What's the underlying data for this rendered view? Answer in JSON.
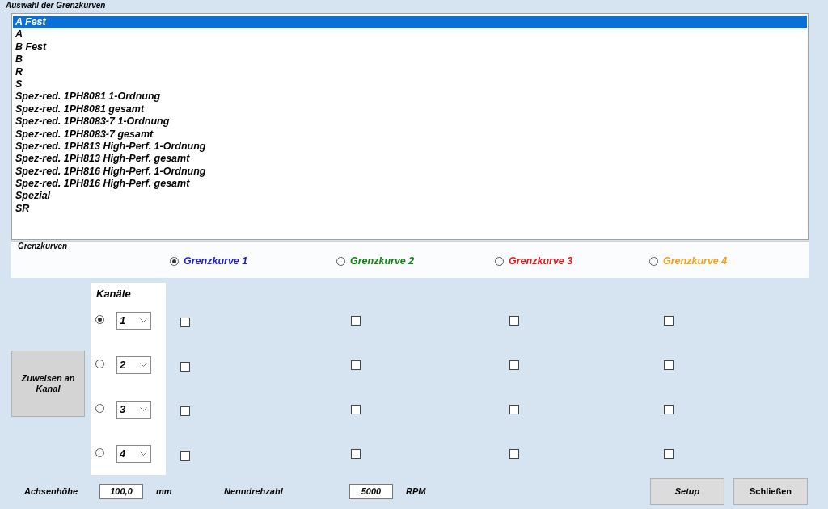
{
  "title": "Auswahl der Grenzkurven",
  "curve_list": {
    "items": [
      {
        "label": "A Fest",
        "selected": true
      },
      {
        "label": "A",
        "selected": false
      },
      {
        "label": "B Fest",
        "selected": false
      },
      {
        "label": "B",
        "selected": false
      },
      {
        "label": "R",
        "selected": false
      },
      {
        "label": "S",
        "selected": false
      },
      {
        "label": "Spez-red. 1PH8081 1-Ordnung",
        "selected": false
      },
      {
        "label": "Spez-red. 1PH8081 gesamt",
        "selected": false
      },
      {
        "label": "Spez-red. 1PH8083-7 1-Ordnung",
        "selected": false
      },
      {
        "label": "Spez-red. 1PH8083-7 gesamt",
        "selected": false
      },
      {
        "label": "Spez-red. 1PH813 High-Perf. 1-Ordnung",
        "selected": false
      },
      {
        "label": "Spez-red. 1PH813 High-Perf. gesamt",
        "selected": false
      },
      {
        "label": "Spez-red. 1PH816 High-Perf. 1-Ordnung",
        "selected": false
      },
      {
        "label": "Spez-red. 1PH816 High-Perf. gesamt",
        "selected": false
      },
      {
        "label": "Spezial",
        "selected": false
      },
      {
        "label": "SR",
        "selected": false
      }
    ]
  },
  "grenzkurven": {
    "label": "Grenzkurven",
    "options": [
      {
        "label": "Grenzkurve 1",
        "selected": true,
        "color": "#1c1cc8"
      },
      {
        "label": "Grenzkurve 2",
        "selected": false,
        "color": "#108010"
      },
      {
        "label": "Grenzkurve 3",
        "selected": false,
        "color": "#e01818"
      },
      {
        "label": "Grenzkurve 4",
        "selected": false,
        "color": "#f0a020"
      }
    ]
  },
  "assign_button": "Zuweisen an Kanal",
  "channels": {
    "label": "Kanäle",
    "rows": [
      {
        "selected": true,
        "value": "1",
        "checks": [
          false,
          false,
          false,
          false
        ]
      },
      {
        "selected": false,
        "value": "2",
        "checks": [
          false,
          false,
          false,
          false
        ]
      },
      {
        "selected": false,
        "value": "3",
        "checks": [
          false,
          false,
          false,
          false
        ]
      },
      {
        "selected": false,
        "value": "4",
        "checks": [
          false,
          false,
          false,
          false
        ]
      }
    ]
  },
  "axis_height": {
    "label": "Achsenhöhe",
    "value": "100,0",
    "unit": "mm"
  },
  "rated_speed": {
    "label": "Nenndrehzahl",
    "value": "5000",
    "unit": "RPM"
  },
  "buttons": [
    {
      "label": "Setup",
      "italic": true
    },
    {
      "label": "Schließen",
      "italic": false
    }
  ]
}
